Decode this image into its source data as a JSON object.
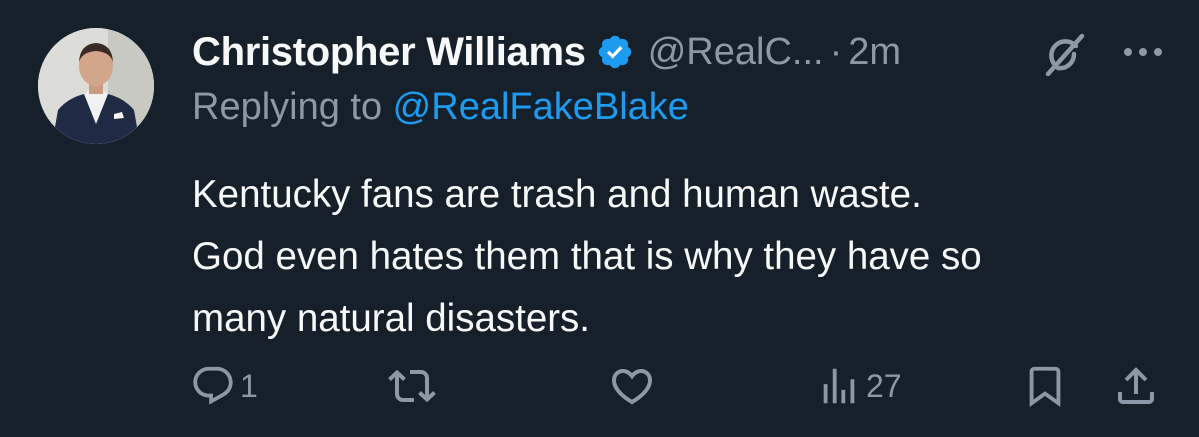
{
  "tweet": {
    "author": {
      "display_name": "Christopher Williams",
      "handle": "@RealC...",
      "verified": true
    },
    "separator": "·",
    "time": "2m",
    "replying_to_prefix": "Replying to ",
    "replying_to_handle": "@RealFakeBlake",
    "text": "Kentucky fans are trash and human waste.\nGod even hates them that is why they have so\nmany natural disasters.",
    "stats": {
      "replies": "1",
      "views": "27"
    }
  },
  "icons": {
    "verified": "verified-badge-icon",
    "grok": "grok-icon",
    "more": "more-icon",
    "reply": "reply-icon",
    "retweet": "retweet-icon",
    "like": "like-icon",
    "views": "views-icon",
    "bookmark": "bookmark-icon",
    "share": "share-icon"
  },
  "colors": {
    "background": "#15202b",
    "text": "#f7f9f9",
    "muted": "#8b98a5",
    "accent": "#1d9bf0"
  }
}
